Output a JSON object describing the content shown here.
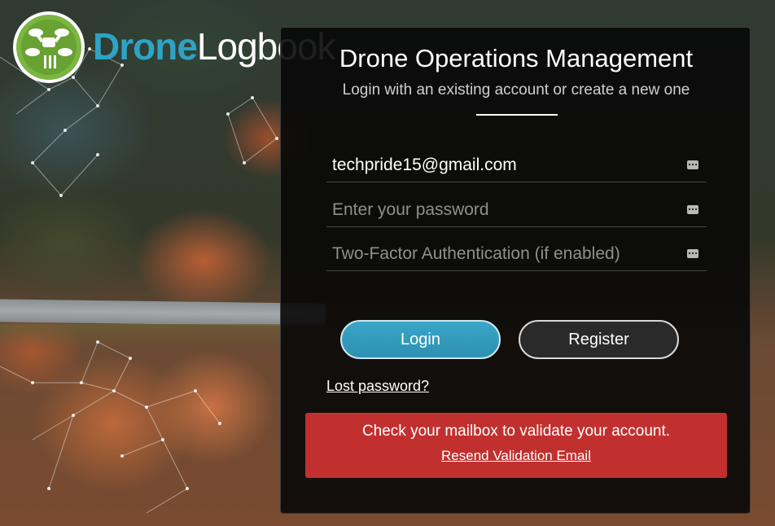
{
  "brand": {
    "name_part1": "Drone",
    "name_part2": "Logbook",
    "accent_color": "#2ea3c6",
    "logo_green": "#7ab641"
  },
  "panel": {
    "title": "Drone Operations Management",
    "subtitle": "Login with an existing account or create a new one"
  },
  "form": {
    "email": {
      "value": "techpride15@gmail.com",
      "placeholder": ""
    },
    "password": {
      "value": "",
      "placeholder": "Enter your password"
    },
    "twofa": {
      "value": "",
      "placeholder": "Two-Factor Authentication (if enabled)"
    },
    "field_icon": "keyboard-icon"
  },
  "buttons": {
    "login": "Login",
    "register": "Register"
  },
  "links": {
    "lost_password": "Lost password?"
  },
  "alert": {
    "message": "Check your mailbox to validate your account.",
    "link": "Resend Validation Email",
    "color": "#c1302f"
  }
}
